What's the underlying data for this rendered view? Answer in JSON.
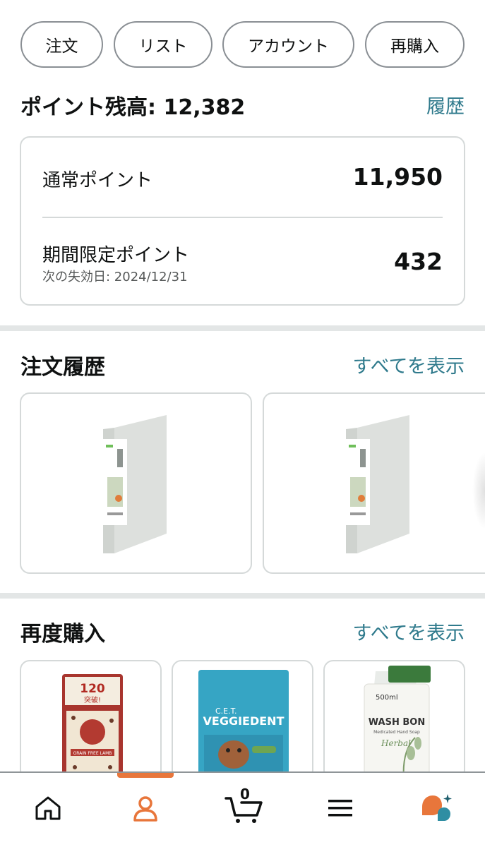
{
  "quick_links": [
    "注文",
    "リスト",
    "アカウント",
    "再購入"
  ],
  "points": {
    "title": "ポイント残高: 12,382",
    "history_link": "履歴",
    "regular_label": "通常ポイント",
    "regular_value": "11,950",
    "limited_label": "期間限定ポイント",
    "limited_expiry": "次の失効日: 2024/12/31",
    "limited_value": "432"
  },
  "order_history": {
    "title": "注文履歴",
    "see_all": "すべてを表示",
    "items": [
      {
        "image": "binder-gray"
      },
      {
        "image": "binder-gray"
      }
    ]
  },
  "buy_again": {
    "title": "再度購入",
    "see_all": "すべてを表示",
    "items": [
      {
        "image": "dog-food-bag",
        "badge_text": "120",
        "badge_sub": "突破!",
        "label": "GRAIN FREE LAMB"
      },
      {
        "image": "dog-dental-chews",
        "brand": "C.E.T.",
        "label": "VEGGIEDENT"
      },
      {
        "image": "hand-soap-refill",
        "volume": "500ml",
        "label": "WASH BON",
        "sublabel": "Medicated Hand Soap",
        "script": "Herbal"
      }
    ]
  },
  "bottom_nav": {
    "items": [
      "home-icon",
      "account-icon",
      "cart-icon",
      "menu-icon",
      "ai-assistant-icon"
    ],
    "active": "account-icon",
    "cart_count": "0",
    "accent_color": "#e8763b"
  },
  "colors": {
    "link": "#2f7a8c",
    "divider": "#e3e6e6",
    "border": "#d5d9d9"
  }
}
